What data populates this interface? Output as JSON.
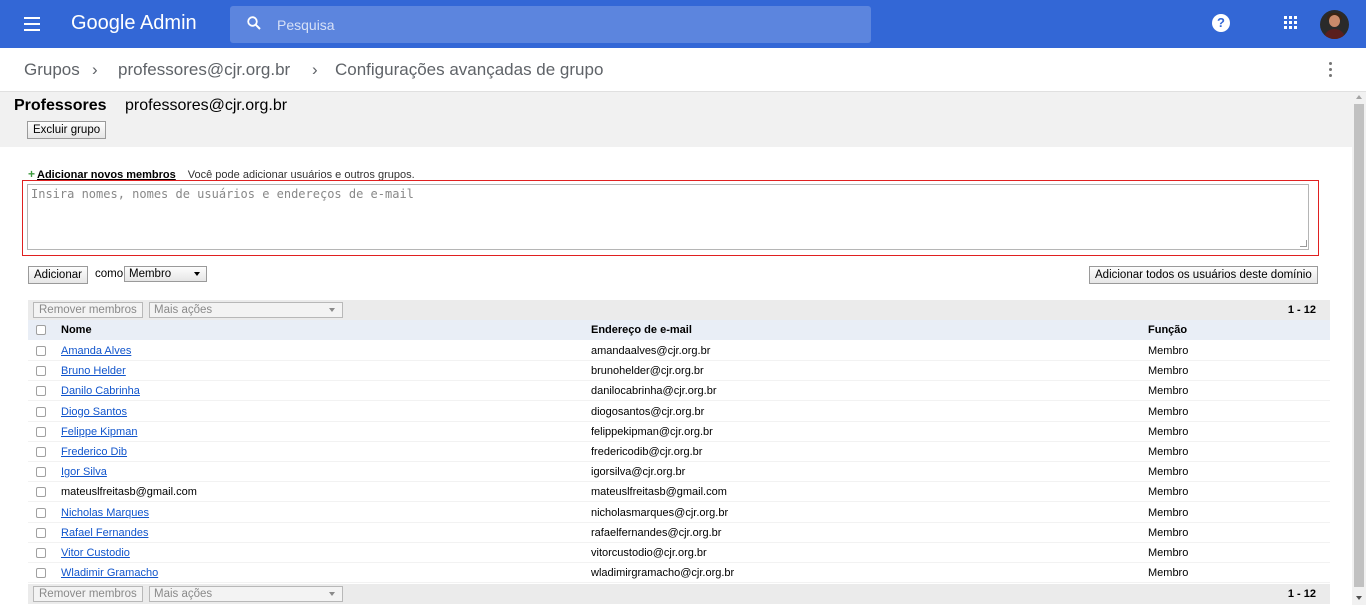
{
  "header": {
    "brand": "Google Admin",
    "search_placeholder": "Pesquisa",
    "help_glyph": "?"
  },
  "breadcrumb": {
    "items": [
      "Grupos",
      "professores@cjr.org.br",
      "Configurações avançadas de grupo"
    ],
    "separator": "›"
  },
  "group": {
    "name": "Professores",
    "email": "professores@cjr.org.br",
    "delete_label": "Excluir grupo"
  },
  "add_members": {
    "title": "Adicionar novos membros",
    "hint": "Você pode adicionar usuários e outros grupos.",
    "placeholder": "Insira nomes, nomes de usuários e endereços de e-mail",
    "add_button": "Adicionar",
    "como_label": "como",
    "role_value": "Membro",
    "add_all_button": "Adicionar todos os usuários deste domínio"
  },
  "toolbar": {
    "remove_label": "Remover membros",
    "more_actions_label": "Mais ações",
    "count": "1 - 12"
  },
  "table": {
    "headers": {
      "name": "Nome",
      "email": "Endereço de e-mail",
      "role": "Função"
    },
    "rows": [
      {
        "name": "Amanda Alves",
        "email": "amandaalves@cjr.org.br",
        "role": "Membro",
        "link": true
      },
      {
        "name": "Bruno Helder",
        "email": "brunohelder@cjr.org.br",
        "role": "Membro",
        "link": true
      },
      {
        "name": "Danilo Cabrinha",
        "email": "danilocabrinha@cjr.org.br",
        "role": "Membro",
        "link": true
      },
      {
        "name": "Diogo Santos",
        "email": "diogosantos@cjr.org.br",
        "role": "Membro",
        "link": true
      },
      {
        "name": "Felippe Kipman",
        "email": "felippekipman@cjr.org.br",
        "role": "Membro",
        "link": true
      },
      {
        "name": "Frederico Dib",
        "email": "fredericodib@cjr.org.br",
        "role": "Membro",
        "link": true
      },
      {
        "name": "Igor Silva",
        "email": "igorsilva@cjr.org.br",
        "role": "Membro",
        "link": true
      },
      {
        "name": "mateuslfreitasb@gmail.com",
        "email": "mateuslfreitasb@gmail.com",
        "role": "Membro",
        "link": false
      },
      {
        "name": "Nicholas Marques",
        "email": "nicholasmarques@cjr.org.br",
        "role": "Membro",
        "link": true
      },
      {
        "name": "Rafael Fernandes",
        "email": "rafaelfernandes@cjr.org.br",
        "role": "Membro",
        "link": true
      },
      {
        "name": "Vitor Custodio",
        "email": "vitorcustodio@cjr.org.br",
        "role": "Membro",
        "link": true
      },
      {
        "name": "Wladimir Gramacho",
        "email": "wladimirgramacho@cjr.org.br",
        "role": "Membro",
        "link": true
      }
    ]
  },
  "colors": {
    "topbar": "#3367d6",
    "link": "#1155cc",
    "highlight_border": "#e02020"
  }
}
